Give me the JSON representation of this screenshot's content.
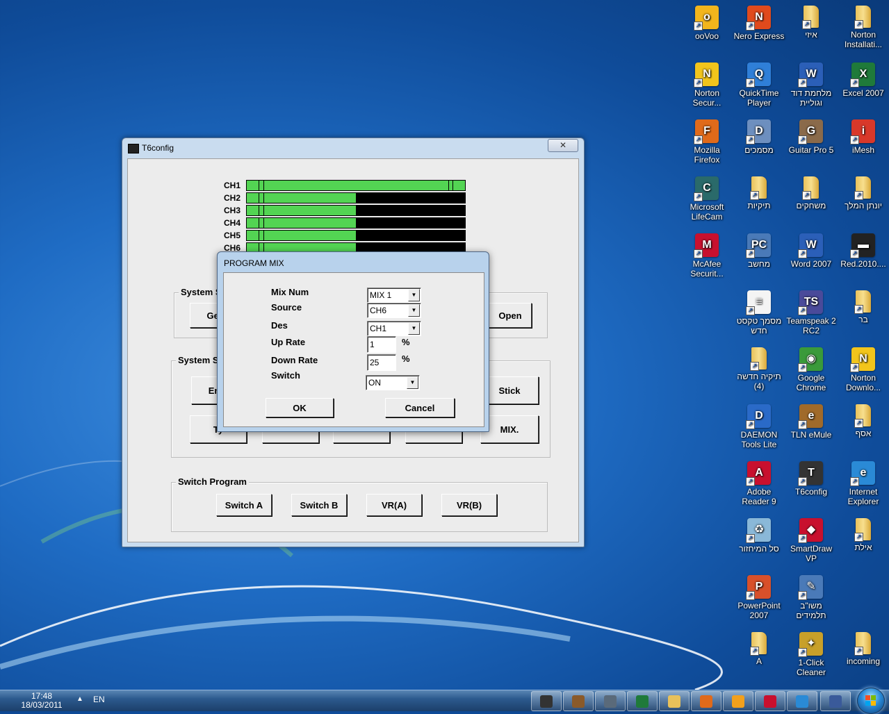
{
  "desktop": {
    "icons": [
      {
        "label": "ooVoo",
        "glyph": "o",
        "color": "#f2b51c"
      },
      {
        "label": "Nero Express",
        "glyph": "N",
        "color": "#e04a1c"
      },
      {
        "label": "איזי",
        "glyph": "",
        "color": "#e8c15a"
      },
      {
        "label": "Norton Installati...",
        "glyph": "",
        "color": "#e8c15a"
      },
      {
        "label": "Norton Secur...",
        "glyph": "N",
        "color": "#f2c51c"
      },
      {
        "label": "QuickTime Player",
        "glyph": "Q",
        "color": "#2f7fd8"
      },
      {
        "label": "מלחמת דוד וגוליית",
        "glyph": "W",
        "color": "#2b5fb8"
      },
      {
        "label": "Excel 2007",
        "glyph": "X",
        "color": "#1f7a3a"
      },
      {
        "label": "Mozilla Firefox",
        "glyph": "F",
        "color": "#e06a1a"
      },
      {
        "label": "מסמכים",
        "glyph": "D",
        "color": "#6d8fbf"
      },
      {
        "label": "Guitar Pro 5",
        "glyph": "G",
        "color": "#8a6a4a"
      },
      {
        "label": "iMesh",
        "glyph": "i",
        "color": "#d8382a"
      },
      {
        "label": "Microsoft LifeCam",
        "glyph": "C",
        "color": "#2a6a6a"
      },
      {
        "label": "תיקיות",
        "glyph": "",
        "color": "#e8c15a"
      },
      {
        "label": "משחקים",
        "glyph": "",
        "color": "#e8c15a"
      },
      {
        "label": "יונתן המלך",
        "glyph": "",
        "color": "#e8c15a"
      },
      {
        "label": "McAfee Securit...",
        "glyph": "M",
        "color": "#c8102e"
      },
      {
        "label": "מחשב",
        "glyph": "PC",
        "color": "#4a7ab8"
      },
      {
        "label": "Word 2007",
        "glyph": "W",
        "color": "#2b5fb8"
      },
      {
        "label": "Red.2010....",
        "glyph": "▬",
        "color": "#222222"
      },
      {
        "label": "מסמך טקסט חדש",
        "glyph": "≡",
        "color": "#f4f4f4"
      },
      {
        "label": "Teamspeak 2 RC2",
        "glyph": "TS",
        "color": "#4a4a9a"
      },
      {
        "label": "בר",
        "glyph": "",
        "color": "#e8c15a"
      },
      {
        "label": "תיקיה חדשה (4)",
        "glyph": "",
        "color": "#e8c15a"
      },
      {
        "label": "Google Chrome",
        "glyph": "◉",
        "color": "#3a9a3a"
      },
      {
        "label": "Norton Downlo...",
        "glyph": "N",
        "color": "#f2c51c"
      },
      {
        "label": "DAEMON Tools Lite",
        "glyph": "D",
        "color": "#2a6ac8"
      },
      {
        "label": "TLN eMule",
        "glyph": "e",
        "color": "#a06a2a"
      },
      {
        "label": "אסף",
        "glyph": "",
        "color": "#e8c15a"
      },
      {
        "label": "Adobe Reader 9",
        "glyph": "A",
        "color": "#c8102e"
      },
      {
        "label": "T6config",
        "glyph": "T",
        "color": "#333333"
      },
      {
        "label": "Internet Explorer",
        "glyph": "e",
        "color": "#2a8ad6"
      },
      {
        "label": "סל המיחזור",
        "glyph": "♻",
        "color": "#8ab8d8"
      },
      {
        "label": "SmartDraw VP",
        "glyph": "◆",
        "color": "#c8102e"
      },
      {
        "label": "אילת",
        "glyph": "",
        "color": "#e8c15a"
      },
      {
        "label": "PowerPoint 2007",
        "glyph": "P",
        "color": "#d8502a"
      },
      {
        "label": "משו\"ב תלמידים",
        "glyph": "✎",
        "color": "#4a7ab8"
      },
      {
        "label": "A",
        "glyph": "",
        "color": "#e8c15a"
      },
      {
        "label": "1-Click Cleaner",
        "glyph": "✦",
        "color": "#c8a02a"
      },
      {
        "label": "incoming",
        "glyph": "",
        "color": "#e8c15a"
      }
    ]
  },
  "t6config": {
    "title": "T6config",
    "close_label": "✕",
    "channels": [
      "CH1",
      "CH2",
      "CH3",
      "CH4",
      "CH5",
      "CH6"
    ],
    "channel_fill": [
      1.0,
      0.5,
      0.5,
      0.5,
      0.5,
      0.5
    ],
    "system_group_title": "System S",
    "system_group_partial_button": "GetU",
    "open_button": "Open",
    "system_setup_title": "System S",
    "end_button": "End",
    "stick_button": "Stick",
    "type_button": "Ty",
    "mix_button": "MIX.",
    "switch_program_title": "Switch Program",
    "switch_buttons": [
      "Switch A",
      "Switch B",
      "VR(A)",
      "VR(B)"
    ]
  },
  "program_mix": {
    "title": "PROGRAM MIX",
    "mix_num_label": "Mix Num",
    "mix_num_value": "MIX 1",
    "source_label": "Source",
    "source_value": "CH6",
    "des_label": "Des",
    "des_value": "CH1",
    "up_rate_label": "Up Rate",
    "up_rate_value": "1",
    "down_rate_label": "Down Rate",
    "down_rate_value": "25",
    "percent": "%",
    "switch_label": "Switch",
    "switch_value": "ON",
    "ok_label": "OK",
    "cancel_label": "Cancel"
  },
  "taskbar": {
    "time": "17:48",
    "date": "18/03/2011",
    "language": "EN",
    "up_arrow": "▲",
    "apps": [
      {
        "name": "t6config-task",
        "color": "#333333"
      },
      {
        "name": "app2-task",
        "color": "#8a5a2a"
      },
      {
        "name": "app3-task",
        "color": "#5a6a7a"
      },
      {
        "name": "excel-task",
        "color": "#1f7a3a"
      },
      {
        "name": "explorer-task",
        "color": "#e8c15a"
      },
      {
        "name": "firefox-task",
        "color": "#e06a1a"
      },
      {
        "name": "media-task",
        "color": "#f2a01c"
      },
      {
        "name": "mcafee-task",
        "color": "#c8102e"
      },
      {
        "name": "ie-task",
        "color": "#2a8ad6"
      },
      {
        "name": "device-task",
        "color": "#3a5a9a"
      }
    ]
  }
}
